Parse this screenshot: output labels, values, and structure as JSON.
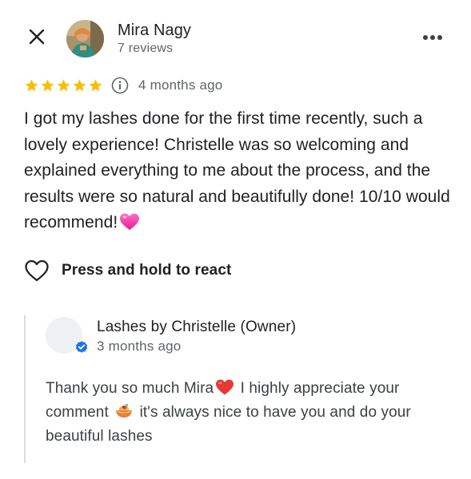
{
  "header": {
    "close_icon": "close-icon",
    "reviewer": {
      "name": "Mira Nagy",
      "reviews_count": "7 reviews"
    },
    "more_icon": "more-horizontal-icon"
  },
  "review": {
    "rating": 5,
    "max_rating": 5,
    "time": "4 months ago",
    "text": "I got my lashes done for the first time recently, such a lovely experience! Christelle was so welcoming and explained everything to me about the process, and the results were so natural and beautifully done! 10/10 would recommend!",
    "trailing_emoji": "pink-heart-emoji",
    "star_color": "#fbbc04"
  },
  "react": {
    "label": "Press and hold to react"
  },
  "owner_reply": {
    "name": "Lashes by Christelle (Owner)",
    "time": "3 months ago",
    "verified_color": "#1a73e8",
    "text_part1": "Thank you so much Mira",
    "text_part2": " I highly appreciate your comment ",
    "text_part3": " it's always nice to have you and do your beautiful lashes"
  }
}
